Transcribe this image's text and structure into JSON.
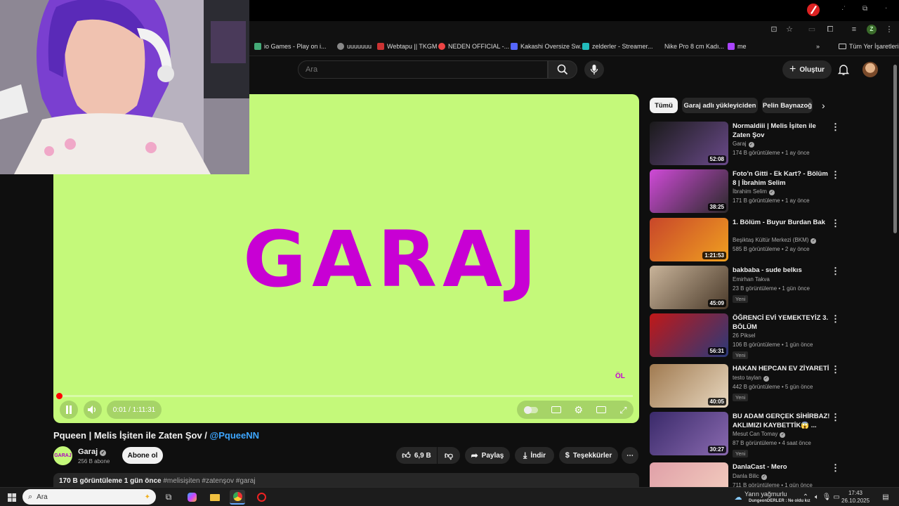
{
  "browser": {
    "bookmarks": [
      {
        "label": "io Games - Play on i...",
        "color": "#4a7"
      },
      {
        "label": "uuuuuuu",
        "color": "#888"
      },
      {
        "label": "Webtapu || TKGM",
        "color": "#c33"
      },
      {
        "label": "NEDEN OFFICIAL -...",
        "color": "#e44"
      },
      {
        "label": "Kakashi Oversize Sw...",
        "color": "#56f"
      },
      {
        "label": "zelderler - Streamer...",
        "color": "#2bb"
      },
      {
        "label": "Nike Pro 8 cm Kadı...",
        "color": "#111"
      },
      {
        "label": "me",
        "color": "#a4f"
      }
    ],
    "all_bookmarks": "Tüm Yer İşaretleri",
    "profile_initial": "Z"
  },
  "header": {
    "search_placeholder": "Ara",
    "create_label": "Oluştur"
  },
  "player": {
    "logo_text": "GARAJ",
    "current_time": "0:01 / 1:11:31",
    "progress_fraction": 0.001,
    "watermark": "ÖL"
  },
  "video": {
    "title_main": "Pqueen | Melis İşiten ile Zaten Şov / ",
    "title_mention": "@PqueeNN",
    "channel_name": "Garaj",
    "channel_avatar_text": "GARAJ",
    "subscribers": "256 B abone",
    "subscribe_label": "Abone ol",
    "likes": "6,9 B",
    "share_label": "Paylaş",
    "download_label": "İndir",
    "thanks_label": "Teşekkürler",
    "desc_stats": "170 B görüntüleme  1 gün önce",
    "desc_tags": "#melisişiten #zatenşov #garaj"
  },
  "sidebar": {
    "chips": [
      "Tümü",
      "Garaj adlı yükleyiciden",
      "Pelin Baynazoğ"
    ],
    "recommendations": [
      {
        "title": "Normaldiii | Melis İşiten ile Zaten Şov",
        "channel": "Garaj",
        "verified": true,
        "stats": "174 B görüntüleme • 1 ay önce",
        "duration": "52:08",
        "new": "",
        "thumb_colors": [
          "#1a1a1a",
          "#6a4a8a"
        ]
      },
      {
        "title": "Foto'n Gitti - Ek Kart? - Bölüm 8 | İbrahim Selim",
        "channel": "İbrahim Selim",
        "verified": true,
        "stats": "171 B görüntüleme • 1 ay önce",
        "duration": "38:25",
        "new": "",
        "thumb_colors": [
          "#d04ad8",
          "#2a2a2a"
        ]
      },
      {
        "title": "1. Bölüm - Buyur Burdan Bak",
        "channel": "Beşiktaş Kültür Merkezi (BKM)",
        "verified": true,
        "stats": "585 B görüntüleme • 2 ay önce",
        "duration": "1:21:53",
        "new": "",
        "thumb_colors": [
          "#c8462a",
          "#f0a020"
        ]
      },
      {
        "title": "bakbaba - sude belkıs",
        "channel": "Emirhan Takva",
        "verified": false,
        "stats": "23 B görüntüleme • 1 gün önce",
        "duration": "45:09",
        "new": "Yeni",
        "thumb_colors": [
          "#c9b49a",
          "#4a3a2a"
        ]
      },
      {
        "title": "ÖĞRENCİ EVİ YEMEKTEYİZ 3. BÖLÜM",
        "channel": "26 Piksel",
        "verified": false,
        "stats": "106 B görüntüleme • 1 gün önce",
        "duration": "56:31",
        "new": "Yeni",
        "thumb_colors": [
          "#c01818",
          "#2a3a7a"
        ]
      },
      {
        "title": "HAKAN HEPCAN EV ZİYARETİ",
        "channel": "testo taylan",
        "verified": true,
        "stats": "442 B görüntüleme • 5 gün önce",
        "duration": "40:05",
        "new": "Yeni",
        "thumb_colors": [
          "#a07a50",
          "#e8d8c0"
        ]
      },
      {
        "title": "BU ADAM GERÇEK SİHİRBAZ! AKLIMIZI KAYBETTİK😱 ...",
        "channel": "Mesut Can Tomay",
        "verified": true,
        "stats": "87 B görüntüleme • 4 saat önce",
        "duration": "30:27",
        "new": "Yeni",
        "thumb_colors": [
          "#3a2a6a",
          "#8a6ab0"
        ]
      },
      {
        "title": "DanlaCast - Mero",
        "channel": "Danla Bilic",
        "verified": true,
        "stats": "711 B görüntüleme • 1 gün önce",
        "duration": "",
        "new": "",
        "thumb_colors": [
          "#e0a0a8",
          "#f4d0c0"
        ]
      }
    ]
  },
  "taskbar": {
    "search_placeholder": "Ara",
    "weather": "Yarın yağmurlu",
    "ticker": "DungeonDERLER : Ne oldu kız",
    "time": "17:43",
    "date": "26.10.2025"
  }
}
